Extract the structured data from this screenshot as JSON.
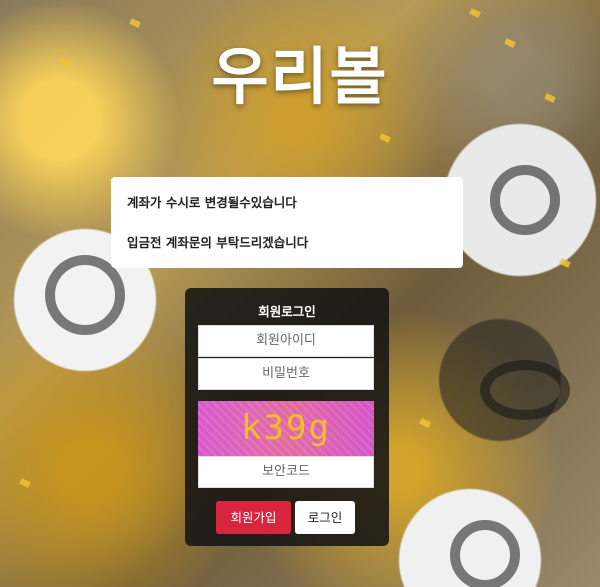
{
  "logo": {
    "text": "우리볼"
  },
  "notice": {
    "line1": "계좌가 수시로 변경될수있습니다",
    "line2": "입금전 계좌문의 부탁드리겠습니다"
  },
  "login": {
    "title": "회원로그인",
    "id_placeholder": "회원아이디",
    "password_placeholder": "비밀번호",
    "captcha_text": "k39g",
    "captcha_placeholder": "보안코드",
    "join_label": "회원가입",
    "login_label": "로그인"
  },
  "colors": {
    "join_button": "#d9263f",
    "panel": "#141414",
    "captcha_bg": "#d85ad0",
    "captcha_text": "#f0c020"
  }
}
